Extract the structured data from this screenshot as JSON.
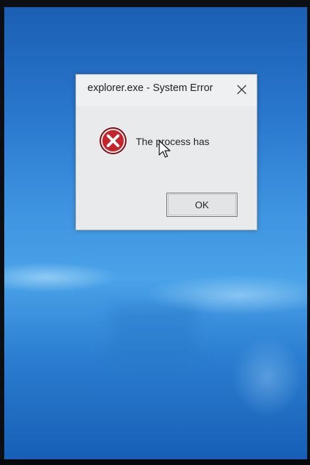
{
  "dialog": {
    "title": "explorer.exe - System Error",
    "message": "The process has",
    "ok_label": "OK",
    "icon": "error-icon",
    "close_icon": "close-icon"
  },
  "cursor": {
    "icon": "mouse-pointer-icon"
  },
  "colors": {
    "desktop_blue": "#2a7dd0",
    "dialog_bg": "#e9eaec",
    "error_red": "#c8222a"
  }
}
